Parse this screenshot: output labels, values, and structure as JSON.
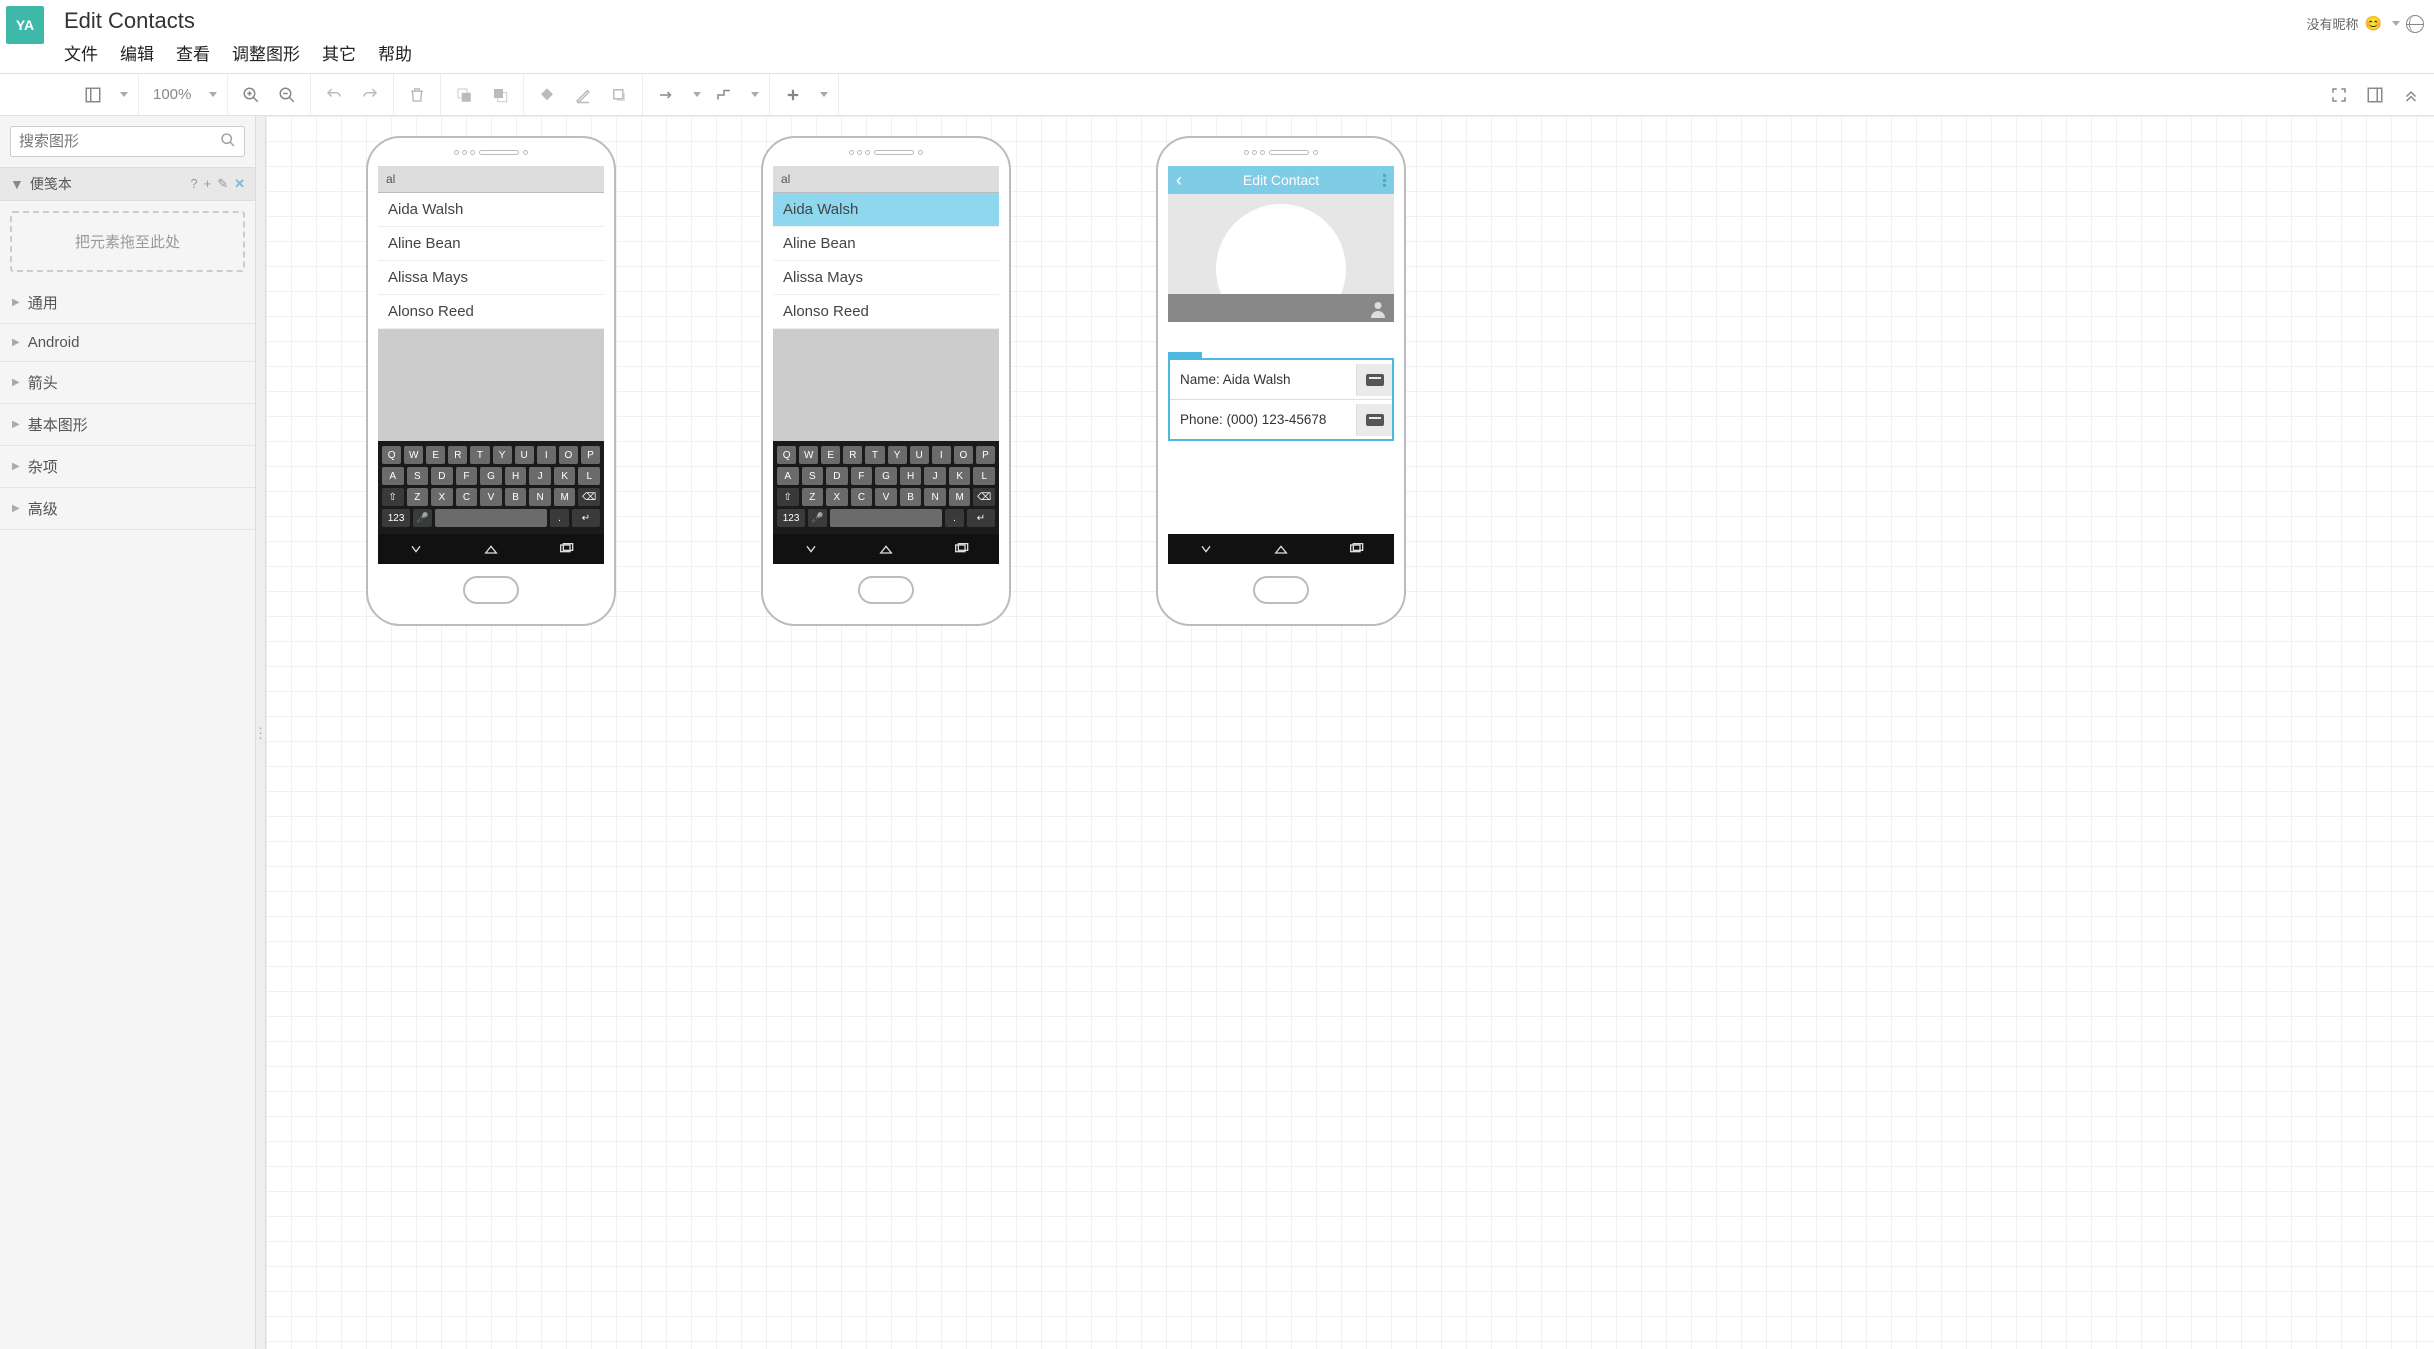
{
  "header": {
    "logo": "YA",
    "title": "Edit Contacts",
    "menu": [
      "文件",
      "编辑",
      "查看",
      "调整图形",
      "其它",
      "帮助"
    ],
    "user_label": "没有昵称"
  },
  "toolbar": {
    "zoom": "100%"
  },
  "sidebar": {
    "search_placeholder": "搜索图形",
    "notes_label": "便笺本",
    "dropzone": "把元素拖至此处",
    "categories": [
      "通用",
      "Android",
      "箭头",
      "基本图形",
      "杂项",
      "高级"
    ]
  },
  "mock": {
    "search_text": "al",
    "contacts": [
      "Aida Walsh",
      "Aline Bean",
      "Alissa Mays",
      "Alonso Reed"
    ],
    "keyboard_rows": [
      [
        "Q",
        "W",
        "E",
        "R",
        "T",
        "Y",
        "U",
        "I",
        "O",
        "P"
      ],
      [
        "A",
        "S",
        "D",
        "F",
        "G",
        "H",
        "J",
        "K",
        "L"
      ],
      [
        "Z",
        "X",
        "C",
        "V",
        "B",
        "N",
        "M"
      ]
    ],
    "num_key": "123",
    "edit_title": "Edit Contact",
    "name_field": "Name: Aida Walsh",
    "phone_field": "Phone: (000) 123-45678"
  }
}
